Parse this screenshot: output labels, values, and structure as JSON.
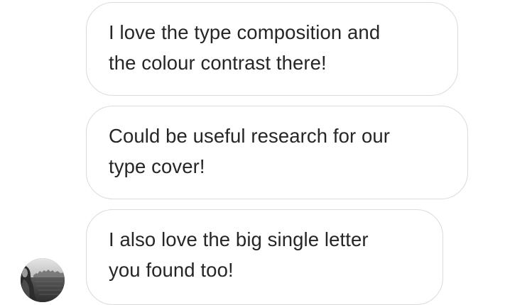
{
  "thread": {
    "messages": [
      {
        "lines": [
          "I love the type composition and",
          "the colour contrast there!"
        ]
      },
      {
        "lines": [
          "Could be useful research for our",
          "type cover!"
        ]
      },
      {
        "lines": [
          "I also love the big single letter",
          "you found too!"
        ]
      }
    ],
    "sender": {
      "avatar_icon": "profile-photo-avatar"
    }
  },
  "colors": {
    "bubble_border": "#dbdbdb",
    "text": "#262626",
    "background": "#ffffff"
  }
}
